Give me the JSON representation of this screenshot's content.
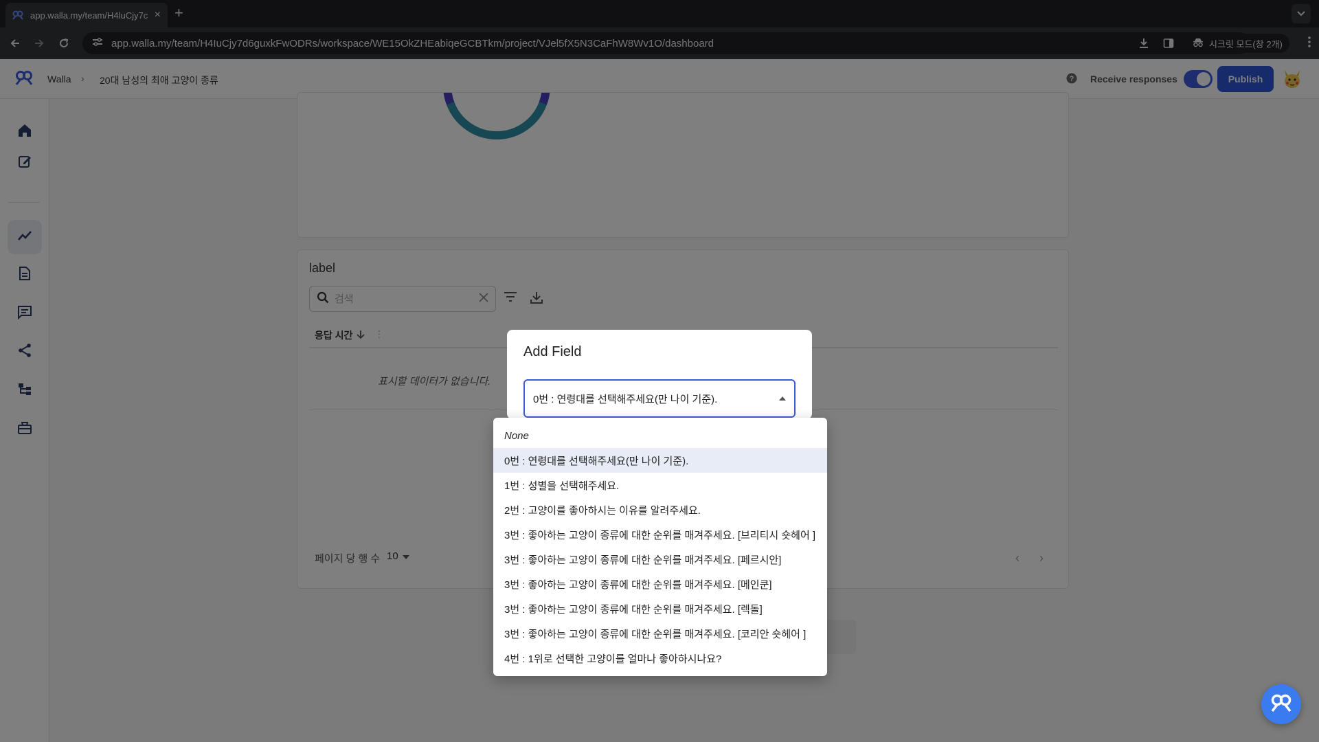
{
  "browser": {
    "tab_title": "app.walla.my/team/H4luCjy7c",
    "url": "app.walla.my/team/H4IuCjy7d6guxkFwODRs/workspace/WE15OkZHEabiqeGCBTkm/project/VJel5fX5N3CaFhW8Wv1O/dashboard",
    "incognito_label": "시크릿 모드(창 2개)"
  },
  "header": {
    "brand": "Walla",
    "project_name": "20대 남성의 최애 고양이 종류",
    "receive_responses_label": "Receive responses",
    "receive_responses_on": true,
    "publish_label": "Publish"
  },
  "sidebar": {
    "items": [
      {
        "icon": "home-icon",
        "active": false
      },
      {
        "icon": "edit-icon",
        "active": false
      },
      {
        "icon": "analytics-icon",
        "active": true
      },
      {
        "icon": "document-icon",
        "active": false
      },
      {
        "icon": "comment-icon",
        "active": false
      },
      {
        "icon": "share-icon",
        "active": false
      },
      {
        "icon": "flow-icon",
        "active": false
      },
      {
        "icon": "integration-icon",
        "active": false
      }
    ]
  },
  "label_card": {
    "title": "label",
    "search_placeholder": "검색",
    "column_header": "응답 시간",
    "empty_message": "표시할 데이터가 없습니다.",
    "rows_per_page_label": "페이지 당 행 수",
    "rows_per_page_value": "10"
  },
  "dialog": {
    "title": "Add Field",
    "selected_value": "0번 : 연령대를 선택해주세요(만 나이 기준).",
    "options": [
      "None",
      "0번 : 연령대를 선택해주세요(만 나이 기준).",
      "1번 : 성별을 선택해주세요.",
      "2번 : 고양이를 좋아하시는 이유를 알려주세요.",
      "3번 : 좋아하는 고양이 종류에 대한 순위를 매겨주세요. [브리티시 숏헤어 ]",
      "3번 : 좋아하는 고양이 종류에 대한 순위를 매겨주세요. [페르시안]",
      "3번 : 좋아하는 고양이 종류에 대한 순위를 매겨주세요. [메인쿤]",
      "3번 : 좋아하는 고양이 종류에 대한 순위를 매겨주세요. [렉돌]",
      "3번 : 좋아하는 고양이 종류에 대한 순위를 매겨주세요. [코리안 숏헤어 ]",
      "4번 : 1위로 선택한 고양이를 얼마나 좋아하시나요?"
    ]
  },
  "colors": {
    "accent": "#2f55d4",
    "donut_teal": "#2f8fa6",
    "donut_indigo": "#4a3fc4"
  }
}
